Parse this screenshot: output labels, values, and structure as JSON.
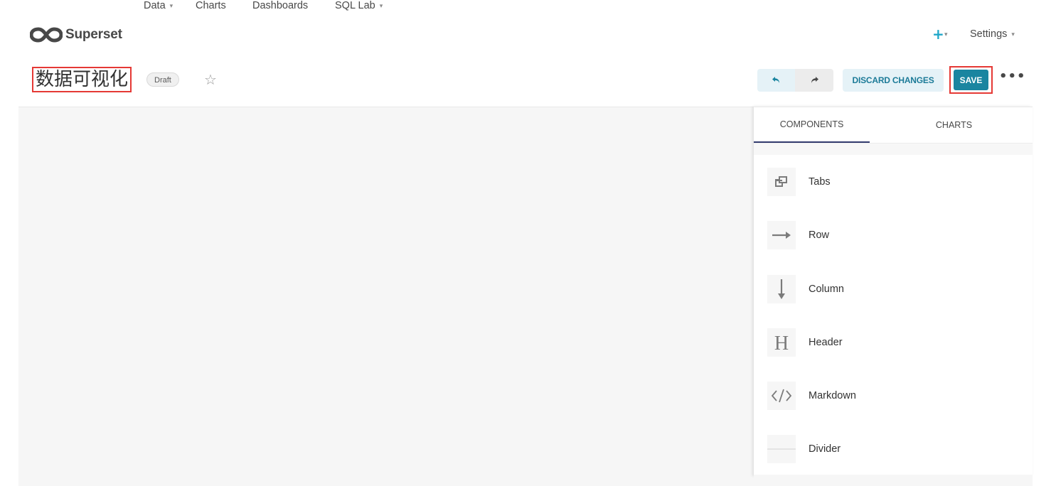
{
  "nav": {
    "brand": "Superset",
    "menu": [
      {
        "label": "Data",
        "has_caret": true
      },
      {
        "label": "Charts",
        "has_caret": false
      },
      {
        "label": "Dashboards",
        "has_caret": false
      },
      {
        "label": "SQL Lab",
        "has_caret": true
      }
    ],
    "plus_icon": "+",
    "settings_label": "Settings",
    "caret": "▾"
  },
  "header": {
    "title": "数据可视化",
    "status_badge": "Draft",
    "favorite_icon": "☆",
    "undo_icon": "undo-icon",
    "redo_icon": "redo-icon",
    "discard_label": "DISCARD CHANGES",
    "save_label": "SAVE",
    "more_icon": "•••"
  },
  "panel": {
    "tabs": [
      {
        "label": "COMPONENTS",
        "active": true
      },
      {
        "label": "CHARTS",
        "active": false
      }
    ],
    "components": [
      {
        "label": "Tabs",
        "icon": "tabs-icon"
      },
      {
        "label": "Row",
        "icon": "row-arrow-icon"
      },
      {
        "label": "Column",
        "icon": "column-arrow-icon"
      },
      {
        "label": "Header",
        "icon": "header-icon"
      },
      {
        "label": "Markdown",
        "icon": "code-icon"
      },
      {
        "label": "Divider",
        "icon": "divider-icon"
      }
    ]
  },
  "colors": {
    "accent": "#1a85a0",
    "plus": "#20a7c9",
    "highlight": "#e53935",
    "tab_underline": "#323b6e"
  }
}
